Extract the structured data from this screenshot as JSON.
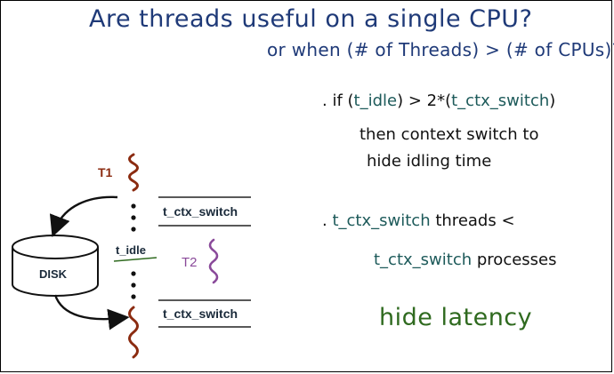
{
  "title": {
    "line1": "Are threads useful on a single CPU?",
    "line2": "or when (# of Threads) > (# of CPUs)?"
  },
  "bullets": {
    "b1_prefix": ". if (",
    "b1_idle": "t_idle",
    "b1_mid": ") > 2*(",
    "b1_ctx": "t_ctx_switch",
    "b1_suffix": ")",
    "b1_line2": "then context switch to",
    "b1_line3": "hide idling time",
    "b2_dot": ".",
    "b2_ctx": "t_ctx_switch",
    "b2_text": "threads <",
    "b2_ctx2": "t_ctx_switch",
    "b2_text2": "processes"
  },
  "conclusion": "hide latency",
  "diagram": {
    "t1_label": "T1",
    "t2_label": "T2",
    "disk_label": "DISK",
    "t_idle_label": "t_idle",
    "ctx_top_label": "t_ctx_switch",
    "ctx_bottom_label": "t_ctx_switch",
    "colors": {
      "thread1": "#8b2b10",
      "thread2": "#8a4a9a",
      "title": "#1f3a78",
      "conclusion": "#2f6a1f",
      "t_idle_underline": "#2f6a1f"
    }
  }
}
